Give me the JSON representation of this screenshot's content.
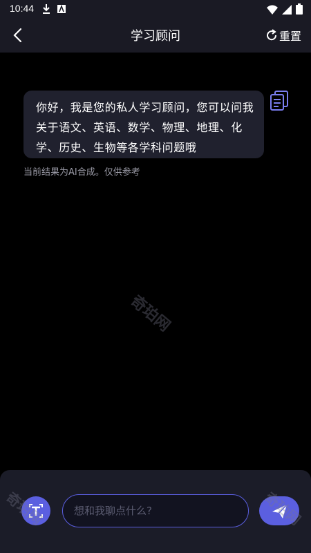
{
  "status_bar": {
    "time": "10:44",
    "icons": [
      "download-icon",
      "app-a-icon",
      "wifi-icon",
      "signal-icon",
      "battery-icon"
    ]
  },
  "header": {
    "title": "学习顾问",
    "reset_label": "重置",
    "back_icon": "chevron-left-icon",
    "reset_icon": "refresh-icon"
  },
  "chat": {
    "messages": [
      {
        "role": "assistant",
        "text": "你好，我是您的私人学习顾问，您可以问我关于语文、英语、数学、物理、地理、化学、历史、生物等各学科问题哦"
      }
    ],
    "ai_note": "当前结果为AI合成。仅供参考",
    "watermark": "奇珀网"
  },
  "composer": {
    "placeholder": "想和我聊点什么?",
    "value": "",
    "ocr_icon": "text-scan-icon",
    "send_icon": "send-icon"
  },
  "colors": {
    "accent": "#5b5fe0",
    "bubble": "#20212e",
    "background": "#000000",
    "bar": "#1a1a24"
  }
}
